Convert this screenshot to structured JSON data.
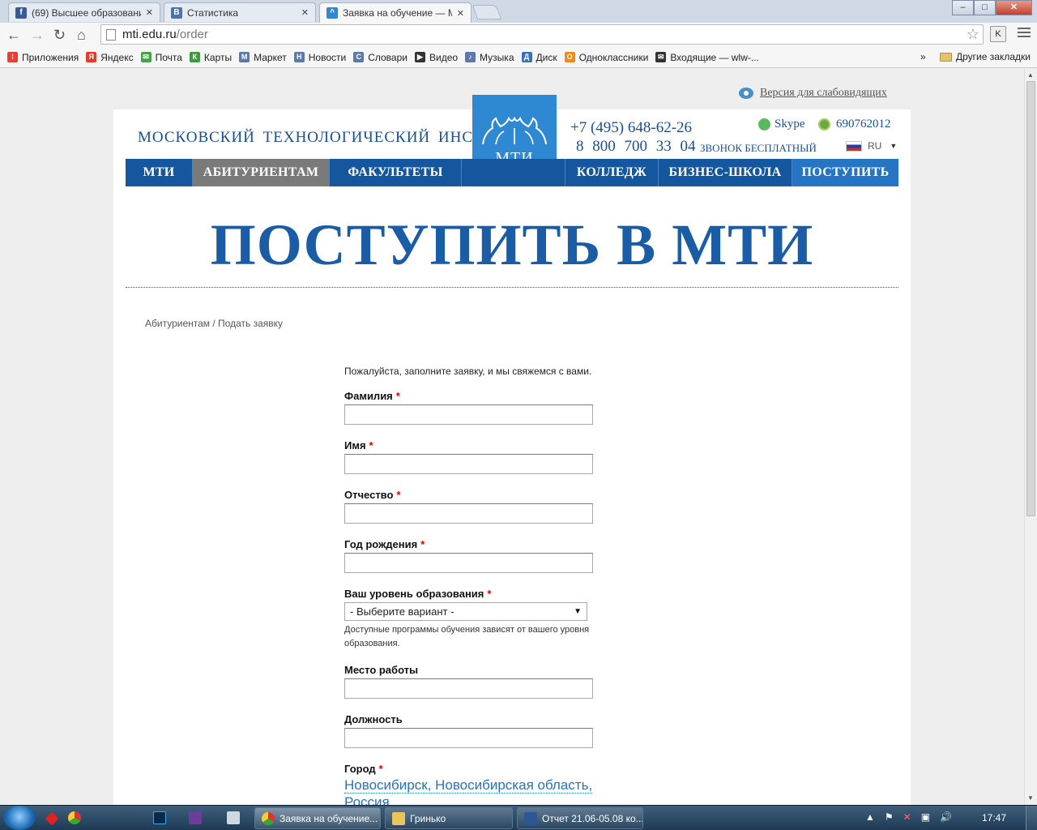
{
  "browser": {
    "tabs": [
      {
        "label": "(69) Высшее образовани",
        "icon": "facebook-icon",
        "color": "#3b5998",
        "glyph": "f"
      },
      {
        "label": "Статистика",
        "icon": "vk-icon",
        "color": "#4c75a3",
        "glyph": "В"
      },
      {
        "label": "Заявка на обучение — М",
        "icon": "mti-icon",
        "color": "#2f88d2",
        "glyph": "^"
      }
    ],
    "tab_close": "✕",
    "nav": {
      "back": "←",
      "forward": "→",
      "reload": "↻",
      "home": "⌂"
    },
    "url_host": "mti.edu.ru",
    "url_path": "/order",
    "star": "☆",
    "ext_label": "K",
    "window": {
      "minimize": "–",
      "maximize": "□",
      "close": "✕"
    },
    "bookmarks": [
      {
        "label": "Приложения",
        "color": "#e34133",
        "glyph": "⁞"
      },
      {
        "label": "Яндекс",
        "color": "#e23b2a",
        "glyph": "Я"
      },
      {
        "label": "Почта",
        "color": "#4aa04a",
        "glyph": "✉"
      },
      {
        "label": "Карты",
        "color": "#3d9a3d",
        "glyph": "К"
      },
      {
        "label": "Маркет",
        "color": "#5c7aa7",
        "glyph": "М"
      },
      {
        "label": "Новости",
        "color": "#5c7aa7",
        "glyph": "Н"
      },
      {
        "label": "Словари",
        "color": "#5c7aa7",
        "glyph": "С"
      },
      {
        "label": "Видео",
        "color": "#333333",
        "glyph": "▶"
      },
      {
        "label": "Музыка",
        "color": "#5c7aa7",
        "glyph": "♪"
      },
      {
        "label": "Диск",
        "color": "#3d6fb5",
        "glyph": "Д"
      },
      {
        "label": "Одноклассники",
        "color": "#f28a1a",
        "glyph": "О"
      },
      {
        "label": "Входящие — wlw-...",
        "color": "#333333",
        "glyph": "✉"
      }
    ],
    "bookmarks_more": "»",
    "other_bookmarks": "Другие закладки"
  },
  "site": {
    "accessibility_link": "Версия для слабовидящих",
    "institute_name": "МОСКОВСКИЙ ТЕХНОЛОГИЧЕСКИЙ ИНСТИТУТ",
    "logo_text": "МТИ",
    "phone1": "+7 (495) 648-62-26",
    "phone2": "8 800 700 33 04",
    "phone2_note": "ЗВОНОК БЕСПЛАТНЫЙ",
    "skype": "Skype",
    "icq": "690762012",
    "lang": "RU",
    "nav": [
      "МТИ",
      "АБИТУРИЕНТАМ",
      "ФАКУЛЬТЕТЫ",
      "КОЛЛЕДЖ",
      "БИЗНЕС-ШКОЛА",
      "ПОСТУПИТЬ"
    ],
    "page_title": "ПОСТУПИТЬ В МТИ",
    "breadcrumb": "Абитуриентам / Подать заявку"
  },
  "form": {
    "intro": "Пожалуйста, заполните заявку, и мы свяжемся с вами.",
    "required_mark": "*",
    "fields": {
      "surname": {
        "label": "Фамилия",
        "value": ""
      },
      "name": {
        "label": "Имя",
        "value": ""
      },
      "patronymic": {
        "label": "Отчество",
        "value": ""
      },
      "birth_year": {
        "label": "Год рождения",
        "value": ""
      },
      "education": {
        "label": "Ваш уровень образования",
        "selected": "- Выберите вариант -",
        "hint": "Доступные программы обучения зависят от вашего уровня образования."
      },
      "workplace": {
        "label": "Место работы",
        "value": ""
      },
      "position": {
        "label": "Должность",
        "value": ""
      },
      "city": {
        "label": "Город",
        "value": "Новосибирск, Новосибирская область, Россия"
      }
    }
  },
  "taskbar": {
    "tasks": [
      {
        "label": "Заявка на обучение...",
        "color": "#e8b83b"
      },
      {
        "label": "Гринько",
        "color": "#e8c65a"
      },
      {
        "label": "Отчет 21.06-05.08 ко...",
        "color": "#2b5797"
      }
    ],
    "tray": [
      "▲",
      "⚑",
      "✕",
      "▣",
      "🔊"
    ],
    "clock": "17:47"
  },
  "colors": {
    "brand_blue": "#15579e",
    "nav_active": "#7a7a7a",
    "title_blue": "#1a5ca6",
    "required_red": "#dd0000",
    "link_blue": "#2673b8"
  }
}
